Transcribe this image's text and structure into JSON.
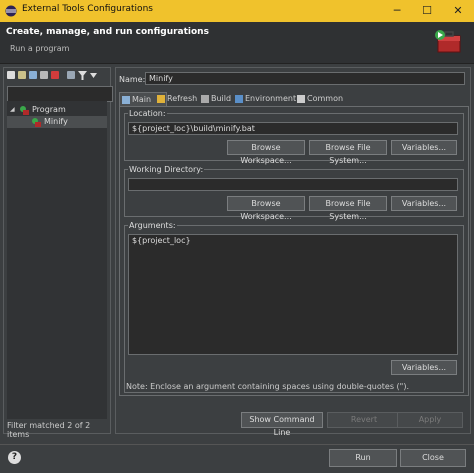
{
  "window": {
    "title": "External Tools Configurations",
    "minimize": "─",
    "maximize": "☐",
    "close": "✕"
  },
  "header": {
    "title": "Create, manage, and run configurations",
    "subtitle": "Run a program"
  },
  "sidebar": {
    "filter_placeholder": "",
    "tree": [
      {
        "label": "Program",
        "expander": "◢"
      },
      {
        "label": "Minify"
      }
    ],
    "status": "Filter matched 2 of 2 items",
    "toolbar_icons": [
      "new-config-icon",
      "new-prototype-icon",
      "export-icon",
      "duplicate-icon",
      "delete-icon",
      "collapse-all-icon",
      "filter-icon",
      "menu-dropdown-icon"
    ]
  },
  "config": {
    "name_label": "Name:",
    "name_value": "Minify",
    "tabs": [
      "Main",
      "Refresh",
      "Build",
      "Environment",
      "Common"
    ],
    "location": {
      "label": "Location:",
      "value": "${project_loc}\\build\\minify.bat",
      "btn_workspace": "Browse Workspace...",
      "btn_filesystem": "Browse File System...",
      "btn_variables": "Variables..."
    },
    "working_dir": {
      "label": "Working Directory:",
      "value": "",
      "btn_workspace": "Browse Workspace...",
      "btn_filesystem": "Browse File System...",
      "btn_variables": "Variables..."
    },
    "arguments": {
      "label": "Arguments:",
      "value": "${project_loc}",
      "btn_variables": "Variables...",
      "note": "Note: Enclose an argument containing spaces using double-quotes (\")."
    },
    "btn_show_cmd": "Show Command Line",
    "btn_revert": "Revert",
    "btn_apply": "Apply"
  },
  "footer": {
    "help": "?",
    "run": "Run",
    "close": "Close"
  }
}
